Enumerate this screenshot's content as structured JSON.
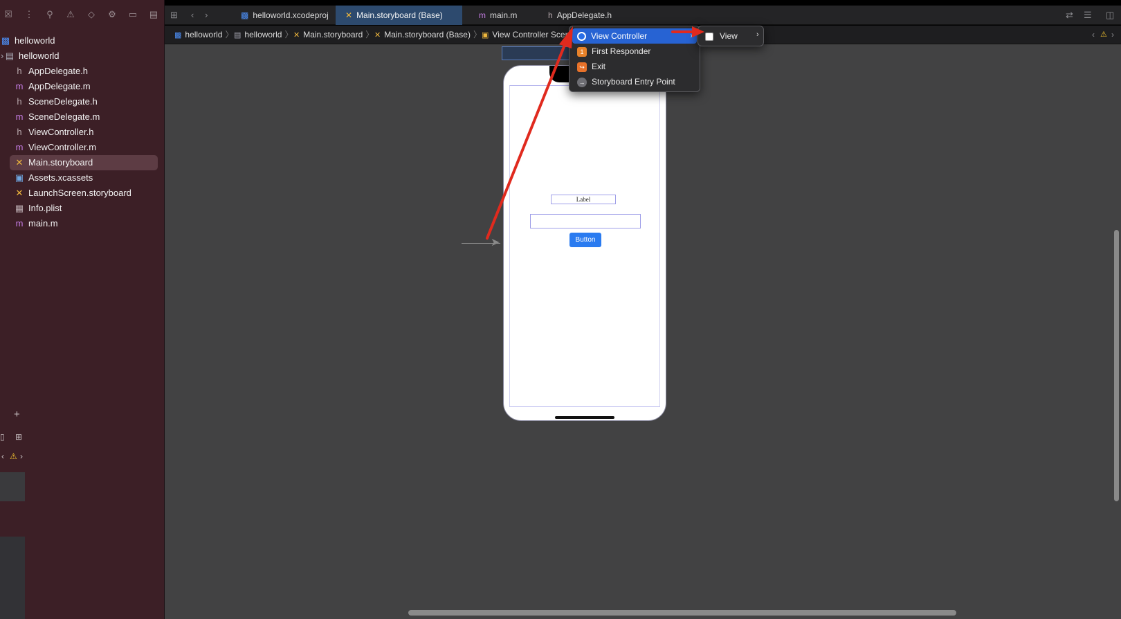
{
  "window": {
    "title": "helloworld"
  },
  "sidebar": {
    "toolbar_icons": [
      "navigator-close-icon",
      "source-control-icon",
      "search-icon",
      "warning-icon",
      "test-icon",
      "debug-icon",
      "breakpoint-icon",
      "report-icon"
    ],
    "items": [
      {
        "label": "helloworld",
        "icon": "project-icon"
      },
      {
        "label": "helloworld",
        "icon": "folder-icon"
      },
      {
        "label": "AppDelegate.h",
        "icon": "h-file-icon"
      },
      {
        "label": "AppDelegate.m",
        "icon": "m-file-icon"
      },
      {
        "label": "SceneDelegate.h",
        "icon": "h-file-icon"
      },
      {
        "label": "SceneDelegate.m",
        "icon": "m-file-icon"
      },
      {
        "label": "ViewController.h",
        "icon": "h-file-icon"
      },
      {
        "label": "ViewController.m",
        "icon": "m-file-icon"
      },
      {
        "label": "Main.storyboard",
        "icon": "storyboard-icon",
        "selected": true
      },
      {
        "label": "Assets.xcassets",
        "icon": "assets-icon"
      },
      {
        "label": "LaunchScreen.storyboard",
        "icon": "storyboard-icon"
      },
      {
        "label": "Info.plist",
        "icon": "plist-icon"
      },
      {
        "label": "main.m",
        "icon": "m-file-icon"
      }
    ]
  },
  "tabs": [
    {
      "label": "helloworld.xcodeproj",
      "icon": "project-icon"
    },
    {
      "label": "Main.storyboard (Base)",
      "icon": "storyboard-icon",
      "active": true
    },
    {
      "label": "main.m",
      "icon": "m-file-icon"
    },
    {
      "label": "AppDelegate.h",
      "icon": "h-file-icon"
    }
  ],
  "breadcrumbs": [
    {
      "label": "helloworld",
      "icon": "project-icon"
    },
    {
      "label": "helloworld",
      "icon": "folder-icon"
    },
    {
      "label": "Main.storyboard",
      "icon": "storyboard-icon"
    },
    {
      "label": "Main.storyboard (Base)",
      "icon": "storyboard-icon"
    },
    {
      "label": "View Controller Scen",
      "icon": "scene-icon"
    }
  ],
  "menu": {
    "items": [
      {
        "label": "View Controller",
        "icon": "view-controller-icon",
        "highlighted": true,
        "submenu": true
      },
      {
        "label": "First Responder",
        "icon": "first-responder-icon"
      },
      {
        "label": "Exit",
        "icon": "exit-icon"
      },
      {
        "label": "Storyboard Entry Point",
        "icon": "entry-point-icon"
      }
    ],
    "submenu": {
      "label": "View",
      "icon": "view-icon"
    }
  },
  "storyboard": {
    "label_text": "Label",
    "button_text": "Button"
  },
  "colors": {
    "sidebar_bg": "#3c1f26",
    "canvas_bg": "#424243",
    "menu_highlight": "#2763d3",
    "annotation_red": "#e02a1e",
    "storyboard_button": "#2a7bf0"
  }
}
